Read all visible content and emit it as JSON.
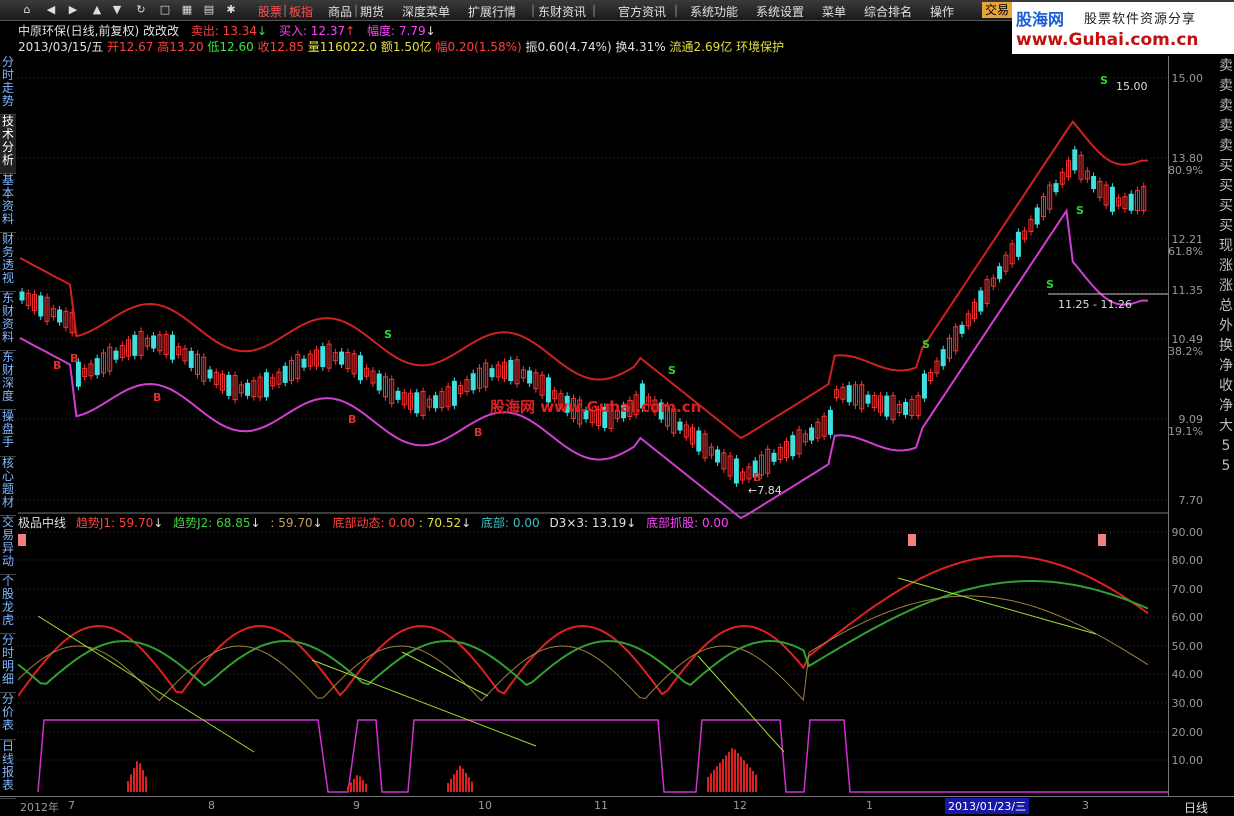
{
  "menubar": {
    "items": [
      "股票",
      "板指",
      "商品",
      "期货",
      "深度菜单",
      "扩展行情",
      "东财资讯",
      "官方资讯",
      "系统功能",
      "系统设置",
      "菜单",
      "综合排名",
      "操作"
    ],
    "trade_tab": "交易"
  },
  "logo": {
    "name": "股海网",
    "tagline": "股票软件资源分享",
    "url": "www.Guhai.com.cn"
  },
  "sidebar": {
    "tabs": [
      "分时走势",
      "技术分析",
      "基本资料",
      "财务透视",
      "东财资料",
      "东财深度",
      "操盘手",
      "核心题材",
      "交易异动",
      "个股龙虎",
      "分时明细",
      "分价表",
      "日线报表"
    ],
    "active": "技术分析"
  },
  "header": {
    "title": "中原环保(日线,前复权) 改改改",
    "sell_label": "卖出: 13.34",
    "buy_label": "买入: 12.37",
    "range_label": "幅度: 7.79",
    "ohlc_date": "2013/03/15/五",
    "open": "开12.67",
    "high": "高13.20",
    "low": "低12.60",
    "close": "收12.85",
    "volume": "量116022.0",
    "amount": "额1.50亿",
    "change": "幅0.20(1.58%)",
    "amplitude": "振0.60(4.74%)",
    "turnover": "换4.31%",
    "float_shares": "流通2.69亿",
    "sector": "环境保护"
  },
  "price_axis": {
    "ticks": [
      "15.00",
      "13.80",
      "12.21",
      "11.35",
      "10.49",
      "9.09",
      "7.70"
    ],
    "pct": [
      "80.9%",
      "61.8%",
      "38.2%",
      "19.1%"
    ],
    "high_label": "15.00",
    "low_label": "7.84",
    "range_label": "11.25 - 11.26"
  },
  "right_strip": [
    "卖",
    "卖",
    "卖",
    "卖",
    "卖",
    "买",
    "买",
    "买",
    "买",
    "现",
    "涨",
    "涨",
    "总",
    "外",
    "换",
    "净",
    "收",
    "净",
    "大",
    "5",
    "5"
  ],
  "indicator": {
    "name": "极品中线",
    "j1": "趋势J1: 59.70",
    "j2": "趋势J2: 68.85",
    "blank": ": 59.70",
    "dynamic": "底部动态: 0.00",
    "value2": ": 70.52",
    "bottom": "底部: 0.00",
    "d3x3": "D3×3: 13.19",
    "grab": "底部抓股: 0.00",
    "ticks": [
      "90.00",
      "80.00",
      "70.00",
      "60.00",
      "50.00",
      "40.00",
      "30.00",
      "20.00",
      "10.00"
    ]
  },
  "xaxis": {
    "labels": [
      "2012年",
      "7",
      "8",
      "9",
      "10",
      "11",
      "12",
      "1",
      "3"
    ],
    "highlight": "2013/01/23/三",
    "period": "日线"
  },
  "colors": {
    "up": "#ff3030",
    "down": "#40e0e0",
    "upper_band": "#d02020",
    "lower_band": "#d040d0",
    "signal_b": "#e03030",
    "signal_s": "#30d030"
  }
}
